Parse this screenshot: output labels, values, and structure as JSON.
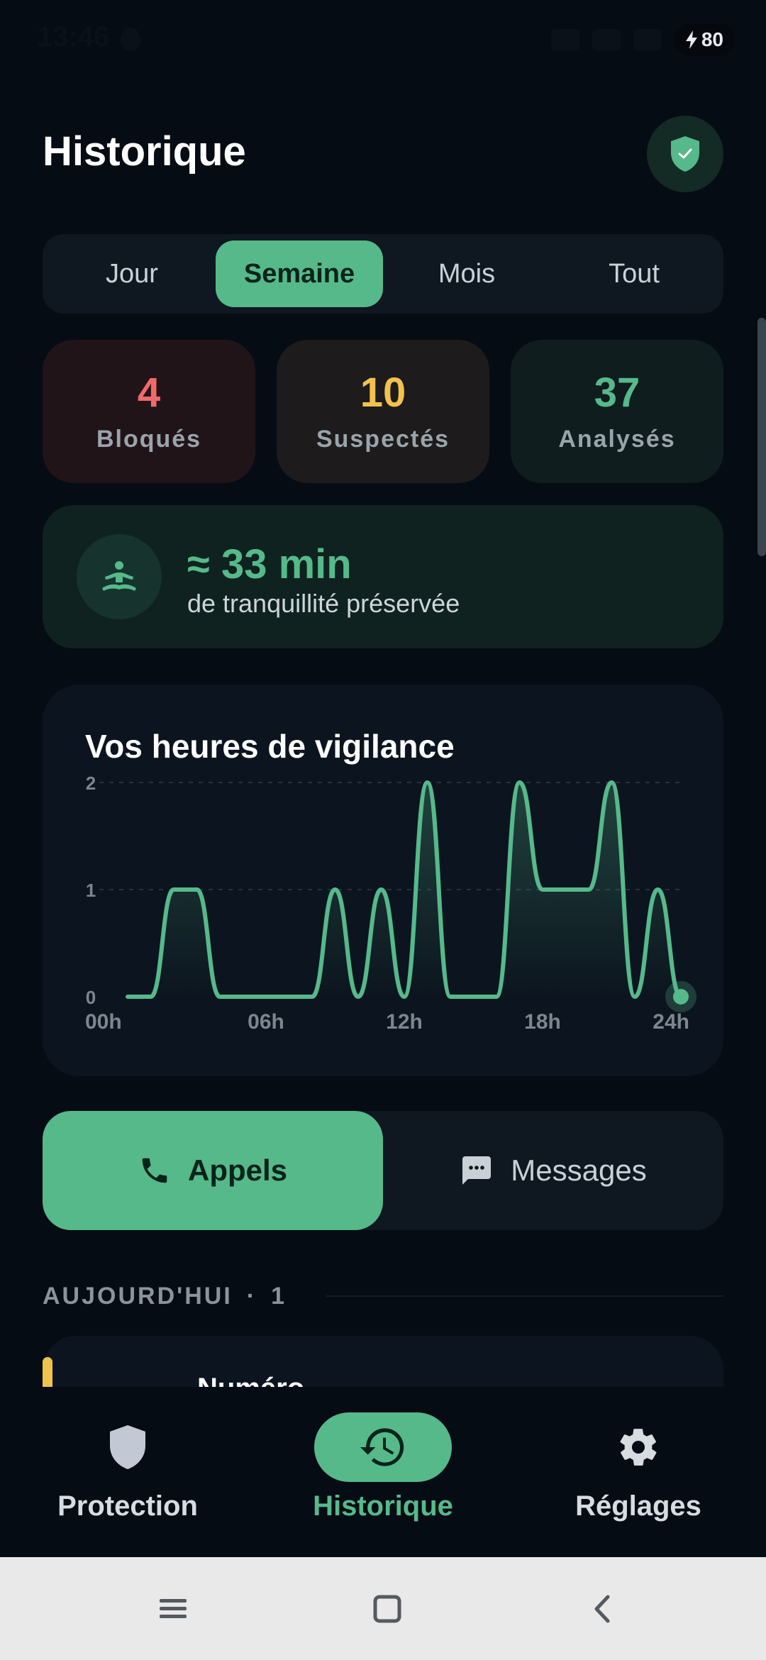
{
  "status_bar": {
    "time": "13:46",
    "battery": "80"
  },
  "header": {
    "title": "Historique"
  },
  "period_tabs": [
    {
      "label": "Jour",
      "active": false
    },
    {
      "label": "Semaine",
      "active": true
    },
    {
      "label": "Mois",
      "active": false
    },
    {
      "label": "Tout",
      "active": false
    }
  ],
  "stats": [
    {
      "value": "4",
      "label": "Bloqués",
      "color": "#f06a6a",
      "bg": "#211419"
    },
    {
      "value": "10",
      "label": "Suspectés",
      "color": "#f4c14f",
      "bg": "#1d1b1c"
    },
    {
      "value": "37",
      "label": "Analysés",
      "color": "#56b98a",
      "bg": "#0f1d1e"
    }
  ],
  "tranquility": {
    "value": "≈ 33 min",
    "label": "de tranquillité préservée"
  },
  "chart_data": {
    "type": "line",
    "title": "Vos heures de vigilance",
    "x": [
      0,
      1,
      2,
      3,
      4,
      5,
      6,
      7,
      8,
      9,
      10,
      11,
      12,
      13,
      14,
      15,
      16,
      17,
      18,
      19,
      20,
      21,
      22,
      23,
      24
    ],
    "values": [
      0,
      0,
      1,
      1,
      0,
      0,
      0,
      0,
      0,
      1,
      0,
      1,
      0,
      2,
      0,
      0,
      0,
      2,
      1,
      1,
      1,
      2,
      0,
      1,
      0
    ],
    "x_tick_labels": [
      "00h",
      "06h",
      "12h",
      "18h",
      "24h"
    ],
    "x_tick_values": [
      0,
      6,
      12,
      18,
      24
    ],
    "y_ticks": [
      0,
      1,
      2
    ],
    "ylim": [
      0,
      2
    ],
    "xlim": [
      0,
      24
    ],
    "grid": true,
    "line_color": "#56b98a"
  },
  "channel_toggle": {
    "calls_label": "Appels",
    "messages_label": "Messages",
    "active": "calls"
  },
  "section": {
    "title": "AUJOURD'HUI",
    "count": "1"
  },
  "list_preview": {
    "title": "Numéro"
  },
  "bottom_nav": [
    {
      "label": "Protection",
      "icon": "shield-icon",
      "active": false
    },
    {
      "label": "Historique",
      "icon": "history-icon",
      "active": true
    },
    {
      "label": "Réglages",
      "icon": "gear-icon",
      "active": false
    }
  ],
  "colors": {
    "accent": "#56b98a",
    "background": "#060c14"
  }
}
